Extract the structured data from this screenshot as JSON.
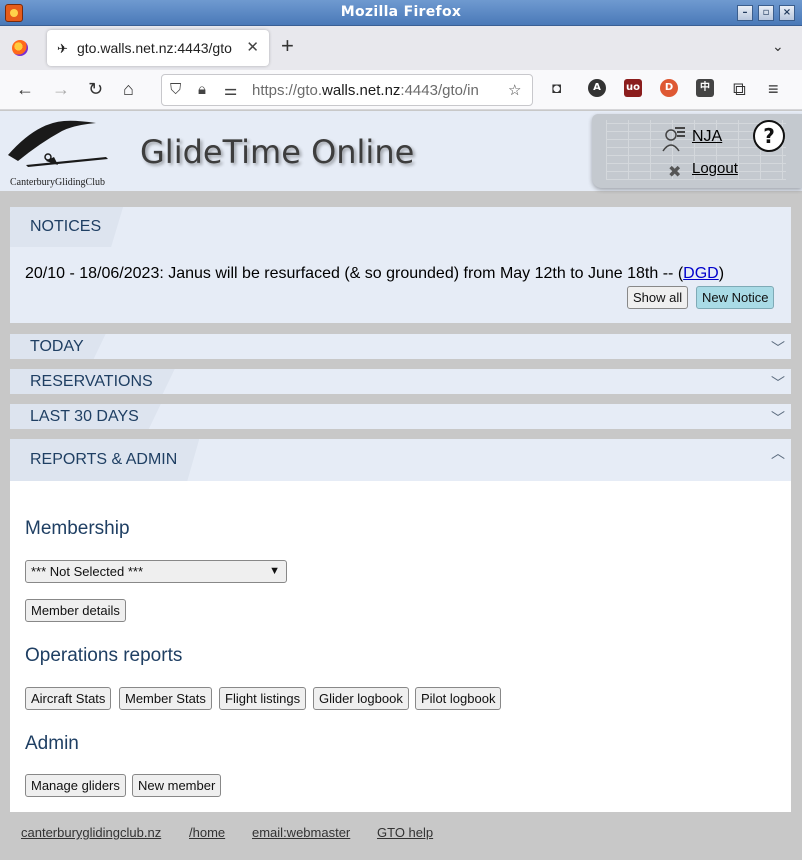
{
  "window": {
    "title": "Mozilla Firefox"
  },
  "tab": {
    "title": "gto.walls.net.nz:4443/gto",
    "close": "✕"
  },
  "urlbar": {
    "prefix": "https://gto.",
    "domain": "walls.net.nz",
    "suffix": ":4443/gto/in"
  },
  "header": {
    "site_title": "GlideTime Online",
    "club_name": "CanterburyGlidingClub",
    "user_code": "NJA",
    "logout_label": "Logout",
    "help_label": "?"
  },
  "notices": {
    "heading": "NOTICES",
    "date": "20/10 - 18/06/2023:",
    "message": "Janus will be resurfaced (& so grounded) from May 12th to June 18th --",
    "author_open": "(",
    "author": "DGD",
    "author_close": ")",
    "show_all": "Show all",
    "new_notice": "New Notice"
  },
  "sections": {
    "today": "TODAY",
    "reservations": "RESERVATIONS",
    "last30": "LAST 30 DAYS",
    "reports": "REPORTS & ADMIN"
  },
  "membership": {
    "heading": "Membership",
    "select_value": "*** Not Selected ***",
    "member_details": "Member details"
  },
  "operations": {
    "heading": "Operations reports",
    "buttons": [
      "Aircraft Stats",
      "Member Stats",
      "Flight listings",
      "Glider logbook",
      "Pilot logbook"
    ]
  },
  "admin": {
    "heading": "Admin",
    "buttons": [
      "Manage gliders",
      "New member"
    ]
  },
  "footer": {
    "links": [
      "canterburyglidingclub.nz",
      "/home",
      "email:webmaster",
      "GTO help"
    ]
  }
}
